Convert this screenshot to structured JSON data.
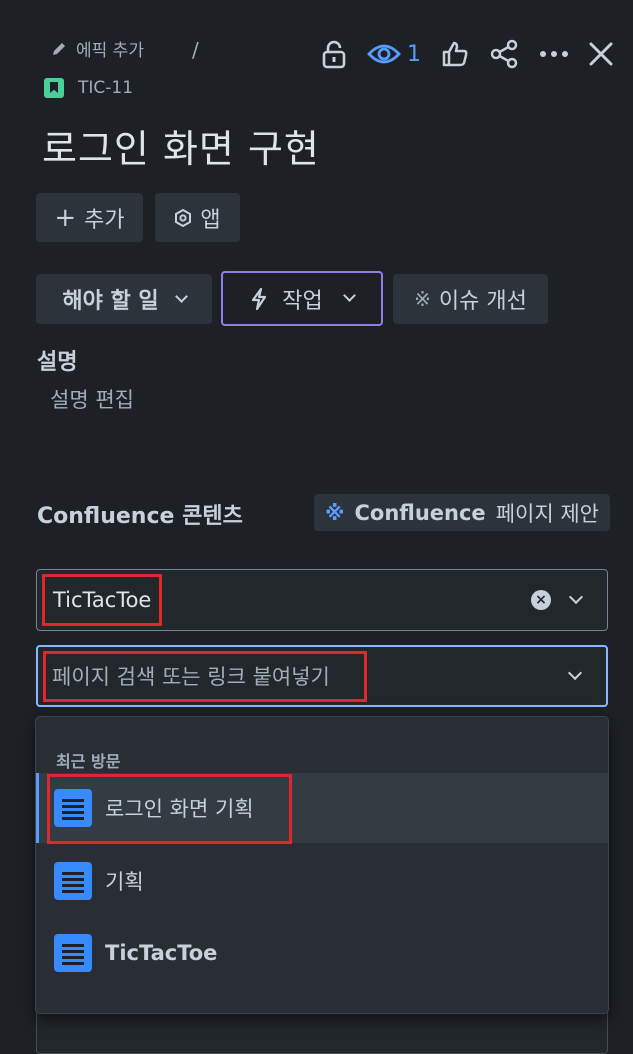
{
  "header": {
    "breadcrumb_epic": "에픽 추가",
    "breadcrumb_sep": "/",
    "issue_key": "TIC-11",
    "watch_count": "1",
    "title": "로그인 화면 구현"
  },
  "actions": {
    "add_label": "추가",
    "apps_label": "앱"
  },
  "workflow": {
    "status": "해야 할 일",
    "action": "작업",
    "improve": "이슈 개선"
  },
  "description": {
    "label": "설명",
    "edit_placeholder": "설명 편집"
  },
  "confluence": {
    "label": "Confluence 콘텐츠",
    "suggest_bold": "Confluence",
    "suggest_tail": "페이지 제안",
    "linked_value": "TicTacToe",
    "search_placeholder": "페이지 검색 또는 링크 붙여넣기"
  },
  "dropdown": {
    "header": "최근 방문",
    "items": [
      {
        "label": "로그인 화면 기획"
      },
      {
        "label": "기획"
      },
      {
        "label": "TicTacToe"
      }
    ]
  },
  "colors": {
    "background": "#1d2125",
    "accent": "#579dff",
    "highlight_box": "#e2262e",
    "story": "#4bce97"
  }
}
